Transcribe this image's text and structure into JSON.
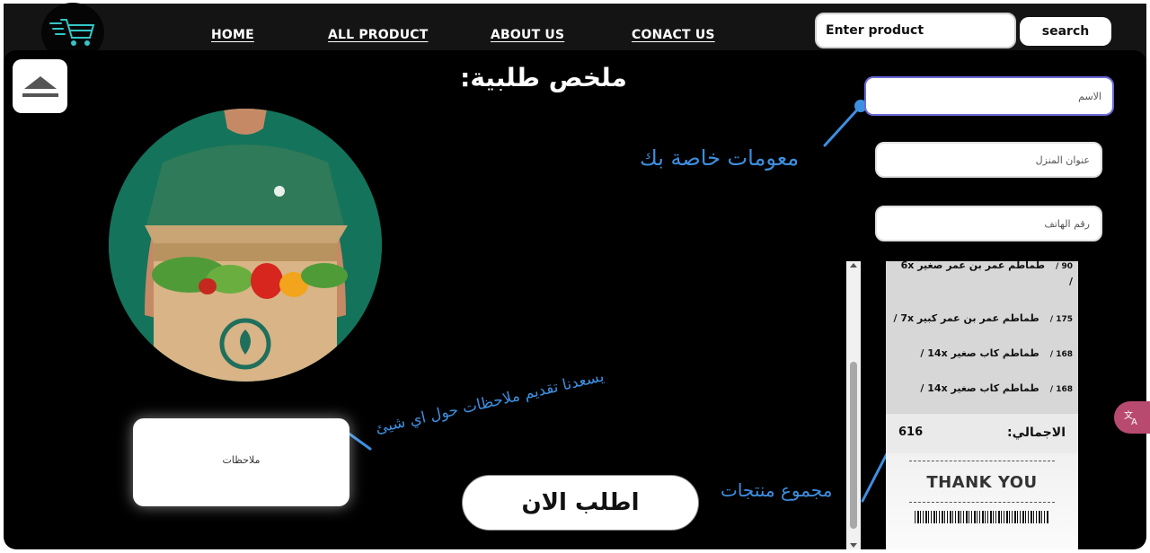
{
  "nav": {
    "links": [
      "HOME",
      "ALL PRODUCT",
      "ABOUT US",
      "CONACT US"
    ],
    "search_placeholder": "Enter product",
    "search_label": "search"
  },
  "page": {
    "title": "ملخص طلبية:",
    "notes_placeholder": "ملاحظات",
    "order_label": "اطلب الان"
  },
  "form": {
    "name_placeholder": "الاسم",
    "address_placeholder": "عنوان المنزل",
    "phone_placeholder": "رقم الهاتف"
  },
  "annotations": {
    "info": "معومات خاصة بك",
    "notes": "يسعدنا تقديم ملاحظات حول اي شيئ",
    "total": "مجموع منتجات"
  },
  "receipt": {
    "items": [
      {
        "name": "طماطم عمر بن عمر صغير 6x",
        "price": "90 /",
        "trail": "/"
      },
      {
        "name": "طماطم عمر بن عمر كبير 7x /",
        "price": "175 /"
      },
      {
        "name": "طماطم كاب صغير 14x /",
        "price": "168 /"
      },
      {
        "name": "طماطم كاب صغير 14x /",
        "price": "168 /"
      }
    ],
    "total_label": "الاجمالي:",
    "total_value": "616",
    "thank_you": "THANK YOU"
  },
  "colors": {
    "annotation": "#3d8fe0",
    "nav_bg": "#141414",
    "main_bg": "#000000"
  }
}
